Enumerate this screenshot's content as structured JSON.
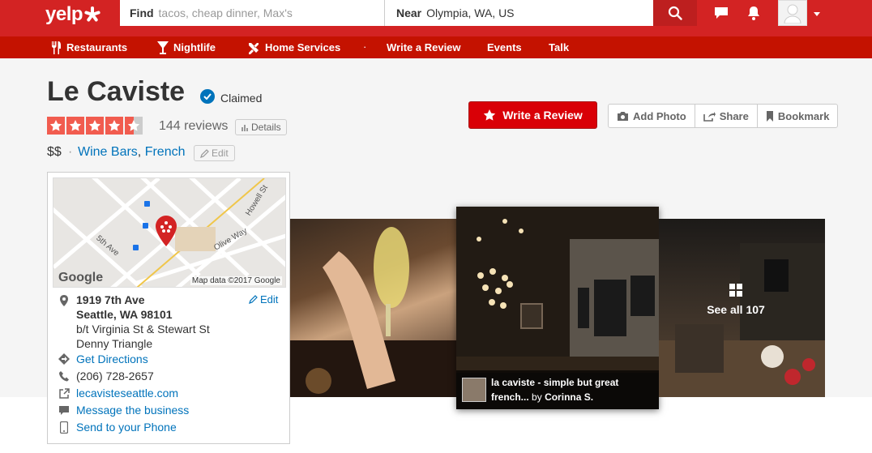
{
  "header": {
    "logo": "yelp",
    "search_find_label": "Find",
    "search_find_placeholder": "tacos, cheap dinner, Max's",
    "search_near_label": "Near",
    "search_near_value": "Olympia, WA, US",
    "icons": [
      "search-icon",
      "messages-icon",
      "notifications-icon",
      "user-avatar",
      "caret-down-icon"
    ]
  },
  "nav": {
    "items": [
      {
        "label": "Restaurants",
        "icon": "fork-knife-icon"
      },
      {
        "label": "Nightlife",
        "icon": "cocktail-icon"
      },
      {
        "label": "Home Services",
        "icon": "tools-icon"
      },
      {
        "label": "Write a Review"
      },
      {
        "label": "Events"
      },
      {
        "label": "Talk"
      }
    ]
  },
  "business": {
    "name": "Le Caviste",
    "claimed": "Claimed",
    "rating": 4.5,
    "review_count": "144 reviews",
    "details": "Details",
    "price": "$$",
    "category_separator": "·",
    "categories": [
      "Wine Bars",
      "French"
    ],
    "edit": "Edit"
  },
  "actions": {
    "write_review": "Write a Review",
    "add_photo": "Add Photo",
    "share": "Share",
    "bookmark": "Bookmark"
  },
  "map": {
    "credit": "Map data ©2017 Google",
    "google": "Google",
    "streets": [
      "5th Ave",
      "Olive Way",
      "Howell St"
    ]
  },
  "address": {
    "street": "1919 7th Ave",
    "city": "Seattle, WA 98101",
    "cross": "b/t Virginia St & Stewart St",
    "neighborhood": "Denny Triangle",
    "edit": "Edit"
  },
  "info": {
    "directions": "Get Directions",
    "phone": "(206) 728-2657",
    "website": "lecavisteseattle.com",
    "message": "Message the business",
    "send_phone": "Send to your Phone"
  },
  "photos": {
    "caption_title": "la caviste - simple but great",
    "caption_title2": "french...",
    "caption_by": "by",
    "caption_author": "Corinna S.",
    "see_all": "See all 107"
  },
  "colors": {
    "brand_red": "#d32323",
    "nav_red": "#c41200",
    "link_blue": "#0073bb",
    "star_red": "#f15c4f"
  }
}
